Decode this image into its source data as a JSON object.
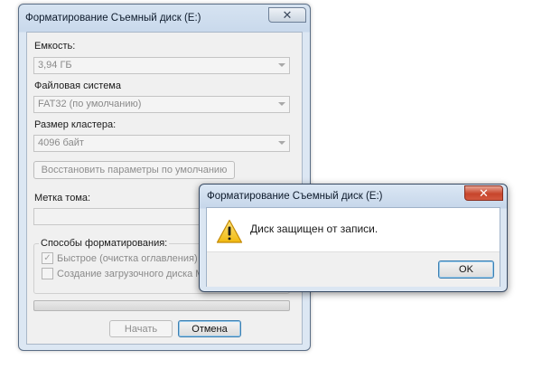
{
  "format_dialog": {
    "title": "Форматирование Съемный диск (E:)",
    "capacity_label": "Емкость:",
    "capacity_value": "3,94 ГБ",
    "filesystem_label": "Файловая система",
    "filesystem_value": "FAT32 (по умолчанию)",
    "cluster_label": "Размер кластера:",
    "cluster_value": "4096 байт",
    "restore_defaults_label": "Восстановить параметры по умолчанию",
    "volume_label_label": "Метка тома:",
    "volume_label_value": "",
    "format_options_label": "Способы форматирования:",
    "quick_format_label": "Быстрое (очистка оглавления)",
    "quick_format_checked": true,
    "boot_disk_label": "Создание загрузочного диска MS-",
    "boot_disk_checked": false,
    "progress": 0,
    "start_label": "Начать",
    "cancel_label": "Отмена",
    "close_glyph": "✕"
  },
  "message_box": {
    "title": "Форматирование Съемный диск (E:)",
    "message": "Диск защищен от записи.",
    "ok_label": "OK",
    "icon": "warning-icon",
    "close_glyph": "✕"
  },
  "colors": {
    "progress_fill": "#4fc14f",
    "warning_yellow": "#f7cf2c",
    "close_red": "#c7452c"
  }
}
